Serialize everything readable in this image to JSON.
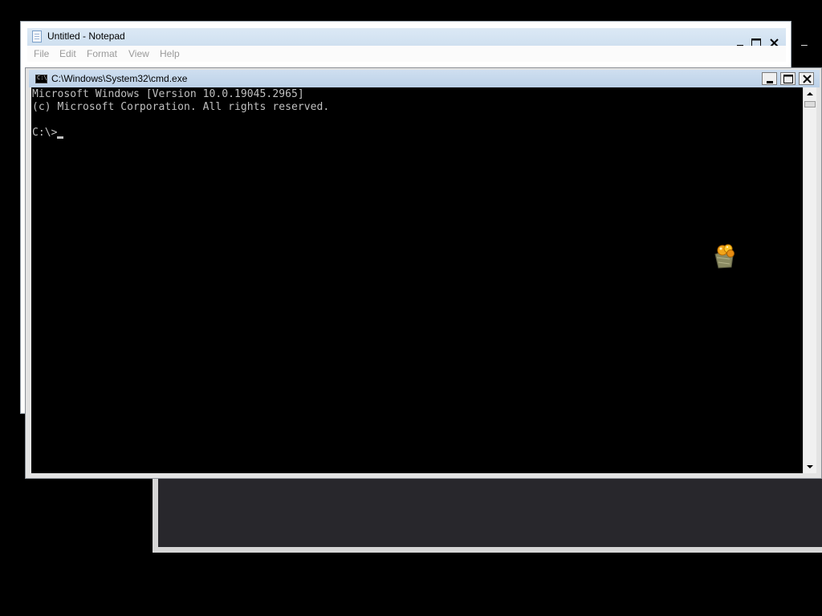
{
  "notepad": {
    "title": "Untitled - Notepad",
    "menu": [
      "File",
      "Edit",
      "Format",
      "View",
      "Help"
    ]
  },
  "cmd": {
    "title": "C:\\Windows\\System32\\cmd.exe",
    "lines": [
      "Microsoft Windows [Version 10.0.19045.2965]",
      "(c) Microsoft Corporation. All rights reserved.",
      "",
      "C:\\>"
    ]
  },
  "icons": {
    "notepad_app": "notepad-icon",
    "cmd_app": "cmd-icon",
    "floating": "balloons-icon"
  },
  "colors": {
    "console_bg": "#000000",
    "console_text": "#c0c0c0",
    "titlebar": "#cfdff0"
  }
}
